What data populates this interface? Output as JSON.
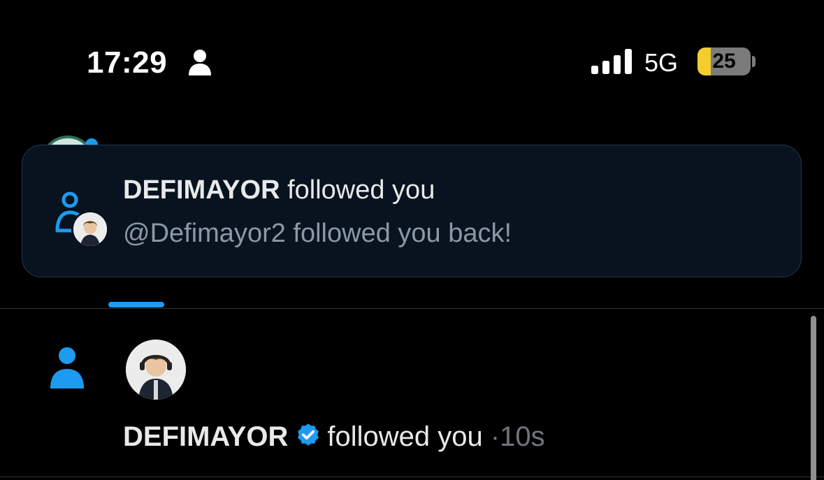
{
  "status_bar": {
    "time": "17:29",
    "network": "5G",
    "battery_level": "25",
    "battery_fraction": 0.25,
    "icons": [
      "focus-person-icon",
      "signal-bars-icon",
      "battery-icon"
    ]
  },
  "toast": {
    "name": "DEFIMAYOR",
    "action": "followed you",
    "subtitle": "@Defimayor2 followed you back!",
    "icon": "follow-person-icon"
  },
  "notification": {
    "name": "DEFIMAYOR",
    "action": "followed you",
    "separator": "·",
    "time_ago": "10s",
    "verified": true,
    "icon": "person-icon"
  },
  "colors": {
    "accent": "#1d9bf0",
    "battery_fill": "#f3cd2c",
    "toast_bg": "#08131f",
    "muted_text": "#71767b"
  }
}
